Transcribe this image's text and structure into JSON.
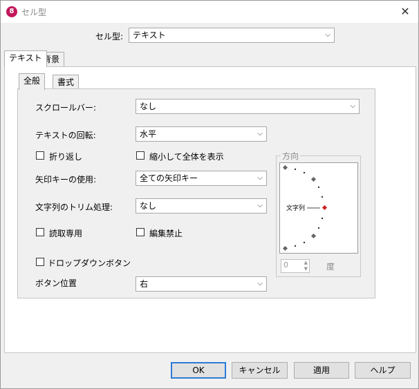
{
  "window": {
    "title": "セル型",
    "app_icon_text": "8",
    "close_glyph": "✕"
  },
  "cell_type": {
    "label": "セル型:",
    "value": "テキスト"
  },
  "outer_tabs": [
    {
      "label": "テキスト",
      "active": true
    },
    {
      "label": "背景",
      "active": false
    }
  ],
  "inner_tabs": [
    {
      "label": "全般",
      "active": true
    },
    {
      "label": "書式",
      "active": false
    }
  ],
  "general": {
    "scrollbar": {
      "label": "スクロールバー:",
      "value": "なし"
    },
    "rotation": {
      "label": "テキストの回転:",
      "value": "水平"
    },
    "wrap": {
      "label": "折り返し",
      "checked": false
    },
    "shrink": {
      "label": "縮小して全体を表示",
      "checked": false
    },
    "arrow_keys": {
      "label": "矢印キーの使用:",
      "value": "全ての矢印キー"
    },
    "trim": {
      "label": "文字列のトリム処理:",
      "value": "なし"
    },
    "read_only": {
      "label": "読取専用",
      "checked": false
    },
    "no_edit": {
      "label": "編集禁止",
      "checked": false
    },
    "dropdown_button": {
      "label": "ドロップダウンボタン",
      "checked": false
    },
    "button_position": {
      "label": "ボタン位置",
      "value": "右"
    }
  },
  "direction": {
    "group_title": "方向",
    "dial_text": "文字列",
    "angle_value": "0",
    "angle_unit": "度",
    "spin_up": "▲",
    "spin_down": "▼"
  },
  "chevron": "⌵",
  "buttons": {
    "ok": "OK",
    "cancel": "キャンセル",
    "apply": "適用",
    "help": "ヘルプ"
  },
  "colors": {
    "accent": "#2b7bd6",
    "dial_marker": "#cc2222"
  }
}
